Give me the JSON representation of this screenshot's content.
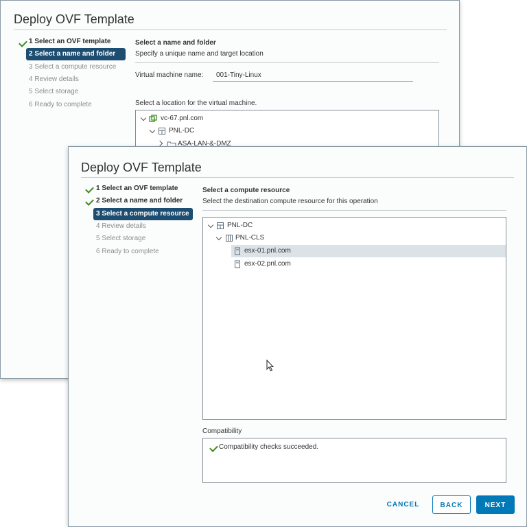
{
  "back_window": {
    "title": "Deploy OVF Template",
    "steps": [
      {
        "label": "1 Select an OVF template",
        "state": "done"
      },
      {
        "label": "2 Select a name and folder",
        "state": "active"
      },
      {
        "label": "3 Select a compute resource",
        "state": "pending"
      },
      {
        "label": "4 Review details",
        "state": "pending"
      },
      {
        "label": "5 Select storage",
        "state": "pending"
      },
      {
        "label": "6 Ready to complete",
        "state": "pending"
      }
    ],
    "section_heading": "Select a name and folder",
    "section_subtitle": "Specify a unique name and target location",
    "vm_name_label": "Virtual machine name:",
    "vm_name_value": "001-Tiny-Linux",
    "location_label": "Select a location for the virtual machine.",
    "tree": [
      {
        "label": "vc-67.pnl.com",
        "icon": "vcenter-icon"
      },
      {
        "label": "PNL-DC",
        "icon": "datacenter-icon"
      },
      {
        "label": "ASA-LAN-&-DMZ",
        "icon": "folder-icon"
      }
    ]
  },
  "front_window": {
    "title": "Deploy OVF Template",
    "steps": [
      {
        "label": "1 Select an OVF template",
        "state": "done"
      },
      {
        "label": "2 Select a name and folder",
        "state": "done"
      },
      {
        "label": "3 Select a compute resource",
        "state": "active"
      },
      {
        "label": "4 Review details",
        "state": "pending"
      },
      {
        "label": "5 Select storage",
        "state": "pending"
      },
      {
        "label": "6 Ready to complete",
        "state": "pending"
      }
    ],
    "section_heading": "Select a compute resource",
    "section_subtitle": "Select the destination compute resource for this operation",
    "tree": [
      {
        "label": "PNL-DC",
        "icon": "datacenter-icon"
      },
      {
        "label": "PNL-CLS",
        "icon": "cluster-icon"
      },
      {
        "label": "esx-01.pnl.com",
        "icon": "host-icon",
        "selected": true
      },
      {
        "label": "esx-02.pnl.com",
        "icon": "host-icon"
      }
    ],
    "compatibility_label": "Compatibility",
    "compatibility_message": "Compatibility checks succeeded.",
    "buttons": {
      "cancel": "CANCEL",
      "back": "BACK",
      "next": "NEXT"
    }
  },
  "colors": {
    "accent": "#0079b8",
    "active_step": "#1d4e71",
    "success": "#3e8b21",
    "selected_row": "#dce3e8"
  }
}
